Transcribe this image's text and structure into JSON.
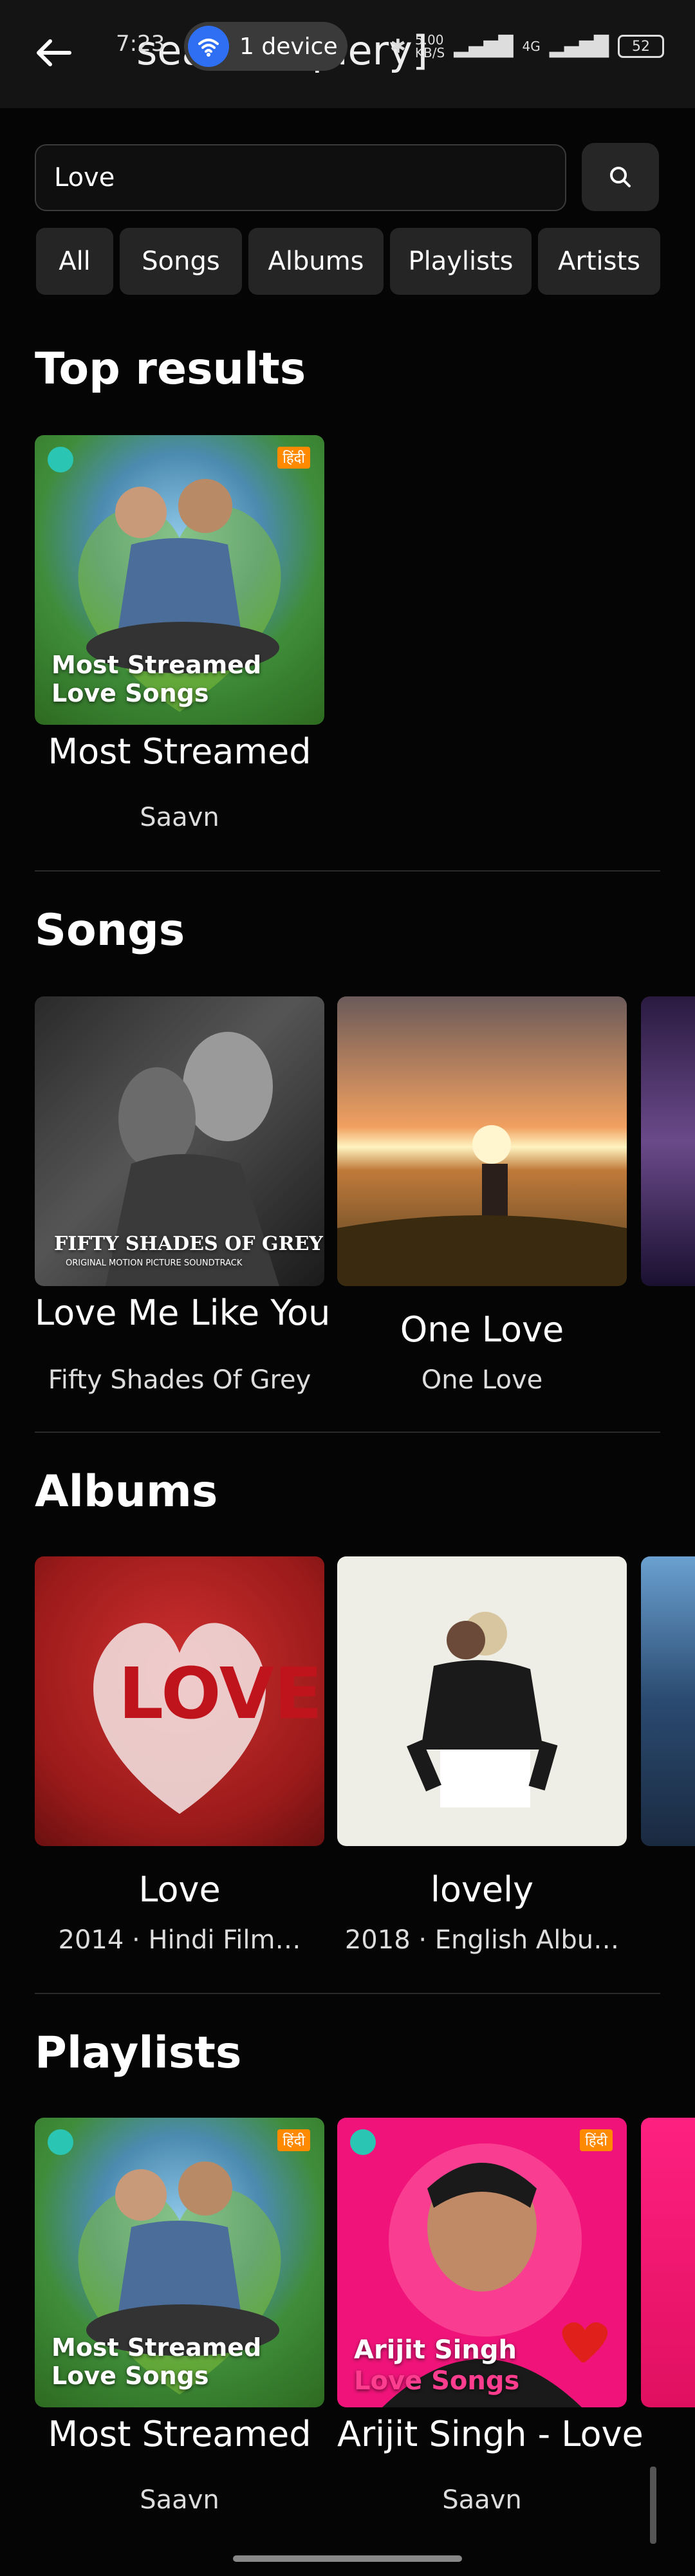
{
  "status_bar": {
    "time": "7:23",
    "device_pill": "1 device",
    "data_speed": "5.00\nKB/S",
    "network": "4G",
    "battery": "52"
  },
  "header": {
    "title": "search [query]"
  },
  "search": {
    "value": "Love"
  },
  "filters": [
    {
      "label": "All"
    },
    {
      "label": "Songs"
    },
    {
      "label": "Albums"
    },
    {
      "label": "Playlists"
    },
    {
      "label": "Artists"
    }
  ],
  "top_results": {
    "heading": "Top results",
    "items": [
      {
        "title": "Most Streamed",
        "subtitle": "Saavn",
        "cover_text": "Most Streamed\nLove Songs",
        "badge": "हिंदी"
      }
    ]
  },
  "songs": {
    "heading": "Songs",
    "items": [
      {
        "title": "Love Me Like You",
        "subtitle": "Fifty Shades Of Grey",
        "cover_text": "FIFTY SHADES OF GREY",
        "cover_subtext": "ORIGINAL MOTION PICTURE SOUNDTRACK"
      },
      {
        "title": "One Love",
        "subtitle": "One Love"
      }
    ]
  },
  "albums": {
    "heading": "Albums",
    "items": [
      {
        "title": "Love",
        "subtitle": "2014 · Hindi Film…",
        "cover_text": "LOVE"
      },
      {
        "title": "lovely",
        "subtitle": "2018 · English Albu…"
      }
    ]
  },
  "playlists": {
    "heading": "Playlists",
    "items": [
      {
        "title": "Most Streamed",
        "subtitle": "Saavn",
        "cover_text": "Most Streamed\nLove Songs",
        "badge": "हिंदी"
      },
      {
        "title": "Arijit Singh - Love",
        "subtitle": "Saavn",
        "cover_text": "Arijit Singh",
        "cover_text2": "Love Songs",
        "badge": "हिंदी"
      }
    ]
  },
  "colors": {
    "background": "#050505",
    "accent_blue": "#2f6ff3",
    "chip_bg": "#252525"
  }
}
